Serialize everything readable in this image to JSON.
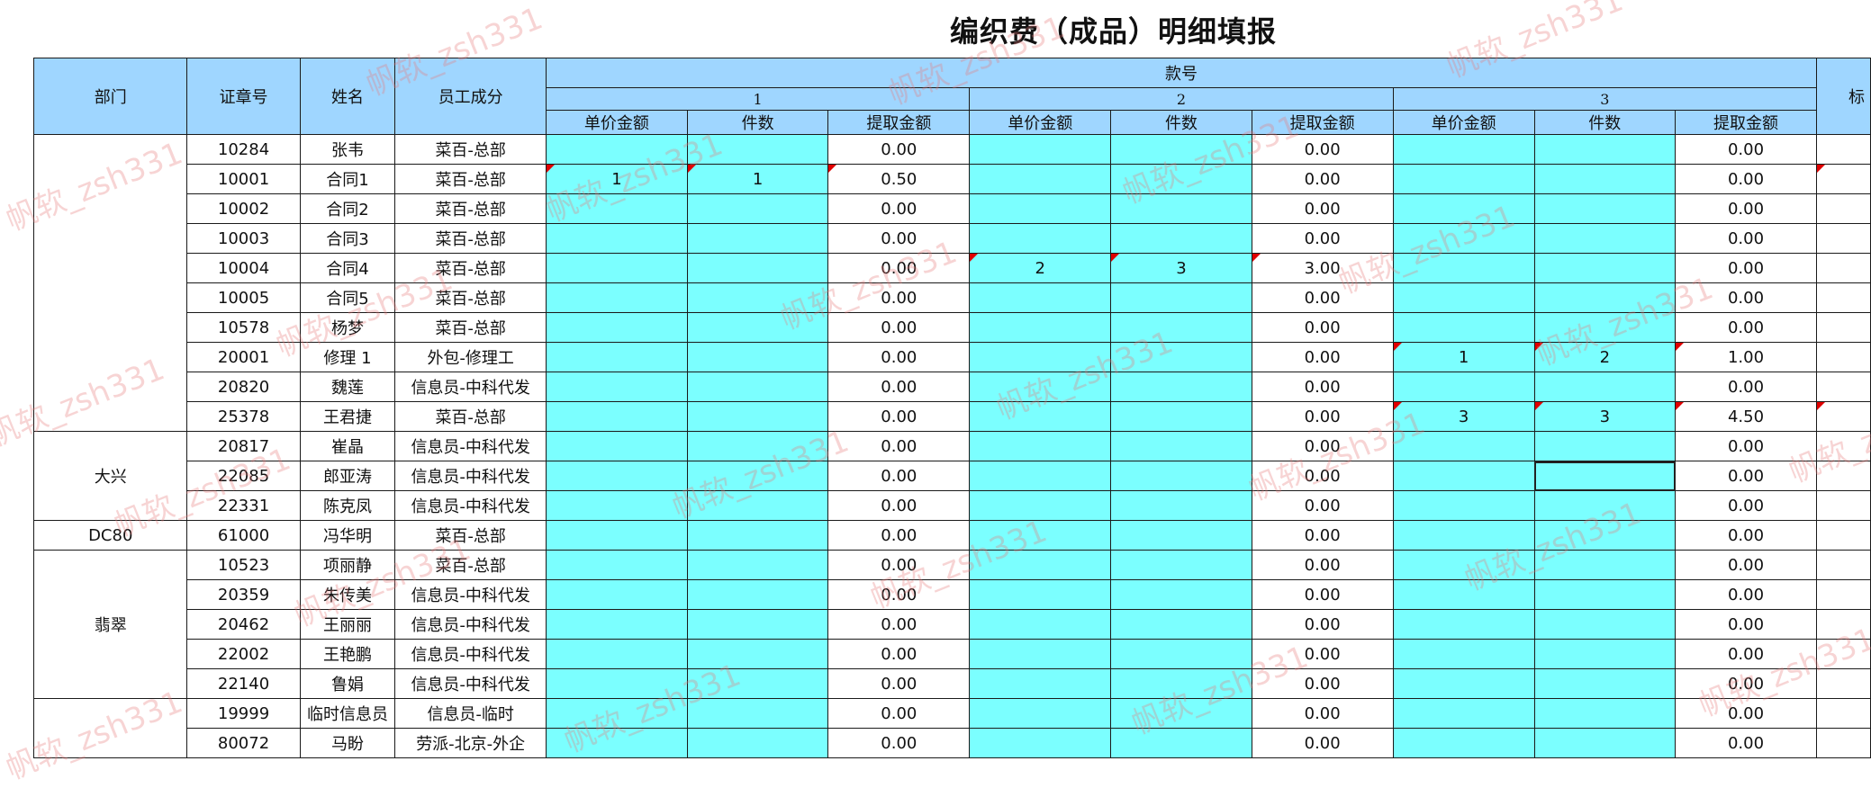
{
  "title": "编织费（成品）明细填报",
  "watermark": "帆软_zsh331",
  "headers": {
    "dept": "部门",
    "cert": "证章号",
    "name": "姓名",
    "comp": "员工成分",
    "style_group": "款号",
    "style_nums": [
      "1",
      "2",
      "3"
    ],
    "sub": [
      "单价金额",
      "件数",
      "提取金额"
    ],
    "cut": "标"
  },
  "rows": [
    {
      "cert": "10284",
      "name": "张韦",
      "comp": "菜百-总部",
      "a": [
        "",
        "",
        "0.00",
        "",
        "",
        "0.00",
        "",
        "",
        "0.00"
      ]
    },
    {
      "cert": "10001",
      "name": "合同1",
      "comp": "菜百-总部",
      "a": [
        "1",
        "1",
        "0.50",
        "",
        "",
        "0.00",
        "",
        "",
        "0.00"
      ]
    },
    {
      "cert": "10002",
      "name": "合同2",
      "comp": "菜百-总部",
      "a": [
        "",
        "",
        "0.00",
        "",
        "",
        "0.00",
        "",
        "",
        "0.00"
      ]
    },
    {
      "cert": "10003",
      "name": "合同3",
      "comp": "菜百-总部",
      "a": [
        "",
        "",
        "0.00",
        "",
        "",
        "0.00",
        "",
        "",
        "0.00"
      ]
    },
    {
      "cert": "10004",
      "name": "合同4",
      "comp": "菜百-总部",
      "a": [
        "",
        "",
        "0.00",
        "2",
        "3",
        "3.00",
        "",
        "",
        "0.00"
      ]
    },
    {
      "cert": "10005",
      "name": "合同5",
      "comp": "菜百-总部",
      "a": [
        "",
        "",
        "0.00",
        "",
        "",
        "0.00",
        "",
        "",
        "0.00"
      ]
    },
    {
      "cert": "10578",
      "name": "杨梦",
      "comp": "菜百-总部",
      "a": [
        "",
        "",
        "0.00",
        "",
        "",
        "0.00",
        "",
        "",
        "0.00"
      ]
    },
    {
      "cert": "20001",
      "name": "修理 1",
      "comp": "外包-修理工",
      "a": [
        "",
        "",
        "0.00",
        "",
        "",
        "0.00",
        "1",
        "2",
        "1.00"
      ]
    },
    {
      "cert": "20820",
      "name": "魏莲",
      "comp": "信息员-中科代发",
      "a": [
        "",
        "",
        "0.00",
        "",
        "",
        "0.00",
        "",
        "",
        "0.00"
      ]
    },
    {
      "cert": "25378",
      "name": "王君捷",
      "comp": "菜百-总部",
      "a": [
        "",
        "",
        "0.00",
        "",
        "",
        "0.00",
        "3",
        "3",
        "4.50"
      ]
    },
    {
      "cert": "20817",
      "name": "崔晶",
      "comp": "信息员-中科代发",
      "a": [
        "",
        "",
        "0.00",
        "",
        "",
        "0.00",
        "",
        "",
        "0.00"
      ]
    },
    {
      "cert": "22085",
      "name": "郎亚涛",
      "comp": "信息员-中科代发",
      "a": [
        "",
        "",
        "0.00",
        "",
        "",
        "0.00",
        "",
        "",
        "0.00"
      ]
    },
    {
      "cert": "22331",
      "name": "陈克凤",
      "comp": "信息员-中科代发",
      "a": [
        "",
        "",
        "0.00",
        "",
        "",
        "0.00",
        "",
        "",
        "0.00"
      ]
    },
    {
      "cert": "61000",
      "name": "冯华明",
      "comp": "菜百-总部",
      "a": [
        "",
        "",
        "0.00",
        "",
        "",
        "0.00",
        "",
        "",
        "0.00"
      ]
    },
    {
      "cert": "10523",
      "name": "项丽静",
      "comp": "菜百-总部",
      "a": [
        "",
        "",
        "0.00",
        "",
        "",
        "0.00",
        "",
        "",
        "0.00"
      ]
    },
    {
      "cert": "20359",
      "name": "朱传美",
      "comp": "信息员-中科代发",
      "a": [
        "",
        "",
        "0.00",
        "",
        "",
        "0.00",
        "",
        "",
        "0.00"
      ]
    },
    {
      "cert": "20462",
      "name": "王丽丽",
      "comp": "信息员-中科代发",
      "a": [
        "",
        "",
        "0.00",
        "",
        "",
        "0.00",
        "",
        "",
        "0.00"
      ]
    },
    {
      "cert": "22002",
      "name": "王艳鹏",
      "comp": "信息员-中科代发",
      "a": [
        "",
        "",
        "0.00",
        "",
        "",
        "0.00",
        "",
        "",
        "0.00"
      ]
    },
    {
      "cert": "22140",
      "name": "鲁娟",
      "comp": "信息员-中科代发",
      "a": [
        "",
        "",
        "0.00",
        "",
        "",
        "0.00",
        "",
        "",
        "0.00"
      ]
    },
    {
      "cert": "19999",
      "name": "临时信息员",
      "comp": "信息员-临时",
      "a": [
        "",
        "",
        "0.00",
        "",
        "",
        "0.00",
        "",
        "",
        "0.00"
      ]
    },
    {
      "cert": "80072",
      "name": "马盼",
      "comp": "劳派-北京-外企",
      "a": [
        "",
        "",
        "0.00",
        "",
        "",
        "0.00",
        "",
        "",
        "0.00"
      ]
    }
  ],
  "depts": [
    {
      "label": "",
      "span": 10
    },
    {
      "label": "大兴",
      "span": 3
    },
    {
      "label": "DC80",
      "span": 1
    },
    {
      "label": "翡翠",
      "span": 5
    },
    {
      "label": "",
      "span": 2
    }
  ],
  "colors": {
    "header": "#9fd6ff",
    "input": "#7bffff",
    "marker": "#e00000"
  }
}
